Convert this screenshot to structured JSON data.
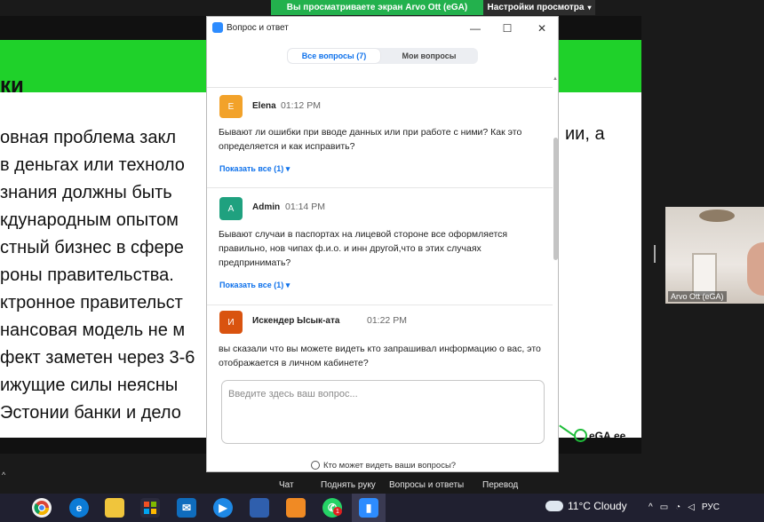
{
  "share_banner": {
    "text": "Вы просматриваете экран Arvo Ott (eGA)"
  },
  "view_settings": {
    "label": "Настройки просмотра",
    "icon": "chevron-down-icon"
  },
  "slide": {
    "title": "ки",
    "lines": [
      "овная проблема закл",
      "в деньгах или техноло",
      " знания должны быть",
      "кдународным опытом",
      "стный бизнес в сфере",
      "роны правительства.",
      "ктронное правительст",
      "нансовая модель не м",
      "фект заметен через 3-6",
      "ижущие силы неясны",
      " Эстонии банки и дело"
    ],
    "right_fragment": "ии, а",
    "logo_text": "eGA.ee"
  },
  "video": {
    "participant_name": "Arvo Ott (eGA)"
  },
  "meeting_toolbar": {
    "chat": "Чат",
    "raise_hand": "Поднять руку",
    "qa": "Вопросы и ответы",
    "translation": "Перевод"
  },
  "qa_window": {
    "title": "Вопрос и ответ",
    "tabs": {
      "all": "Все вопросы (7)",
      "mine": "Мои вопросы"
    },
    "questions": [
      {
        "initial": "E",
        "author": "Elena",
        "time": "01:12 PM",
        "color": "#f2a22a",
        "text": "Бывают ли ошибки при вводе данных или при работе с ними? Как это определяется и как исправить?",
        "show_all": "Показать все (1)"
      },
      {
        "initial": "A",
        "author": "Admin",
        "time": "01:14 PM",
        "color": "#1fa17f",
        "text": "Бывают случаи в паспортах на лицевой стороне все оформляется правильно, нов чипах ф.и.о. и инн другой,что в этих случаях предпринимать?",
        "show_all": "Показать все (1)"
      },
      {
        "initial": "И",
        "author": "Искендер Ысык-ата",
        "time": "01:22 PM",
        "color": "#d9530f",
        "text": "вы сказали что вы можете видеть кто запрашивал информацию о вас, это отображается в личном кабинете?"
      }
    ],
    "input_placeholder": "Введите здесь ваш вопрос...",
    "input_value": "",
    "footer": "Кто может видеть ваши вопросы?"
  },
  "taskbar": {
    "weather": "11°C  Cloudy",
    "language": "РУС",
    "badge": "1",
    "apps": [
      "windows-start-icon",
      "search-icon",
      "chrome-icon",
      "edge-icon",
      "file-explorer-icon",
      "store-icon",
      "mail-icon",
      "media-icon",
      "app-icon",
      "app-orange-icon",
      "whatsapp-icon",
      "zoom-icon"
    ]
  }
}
